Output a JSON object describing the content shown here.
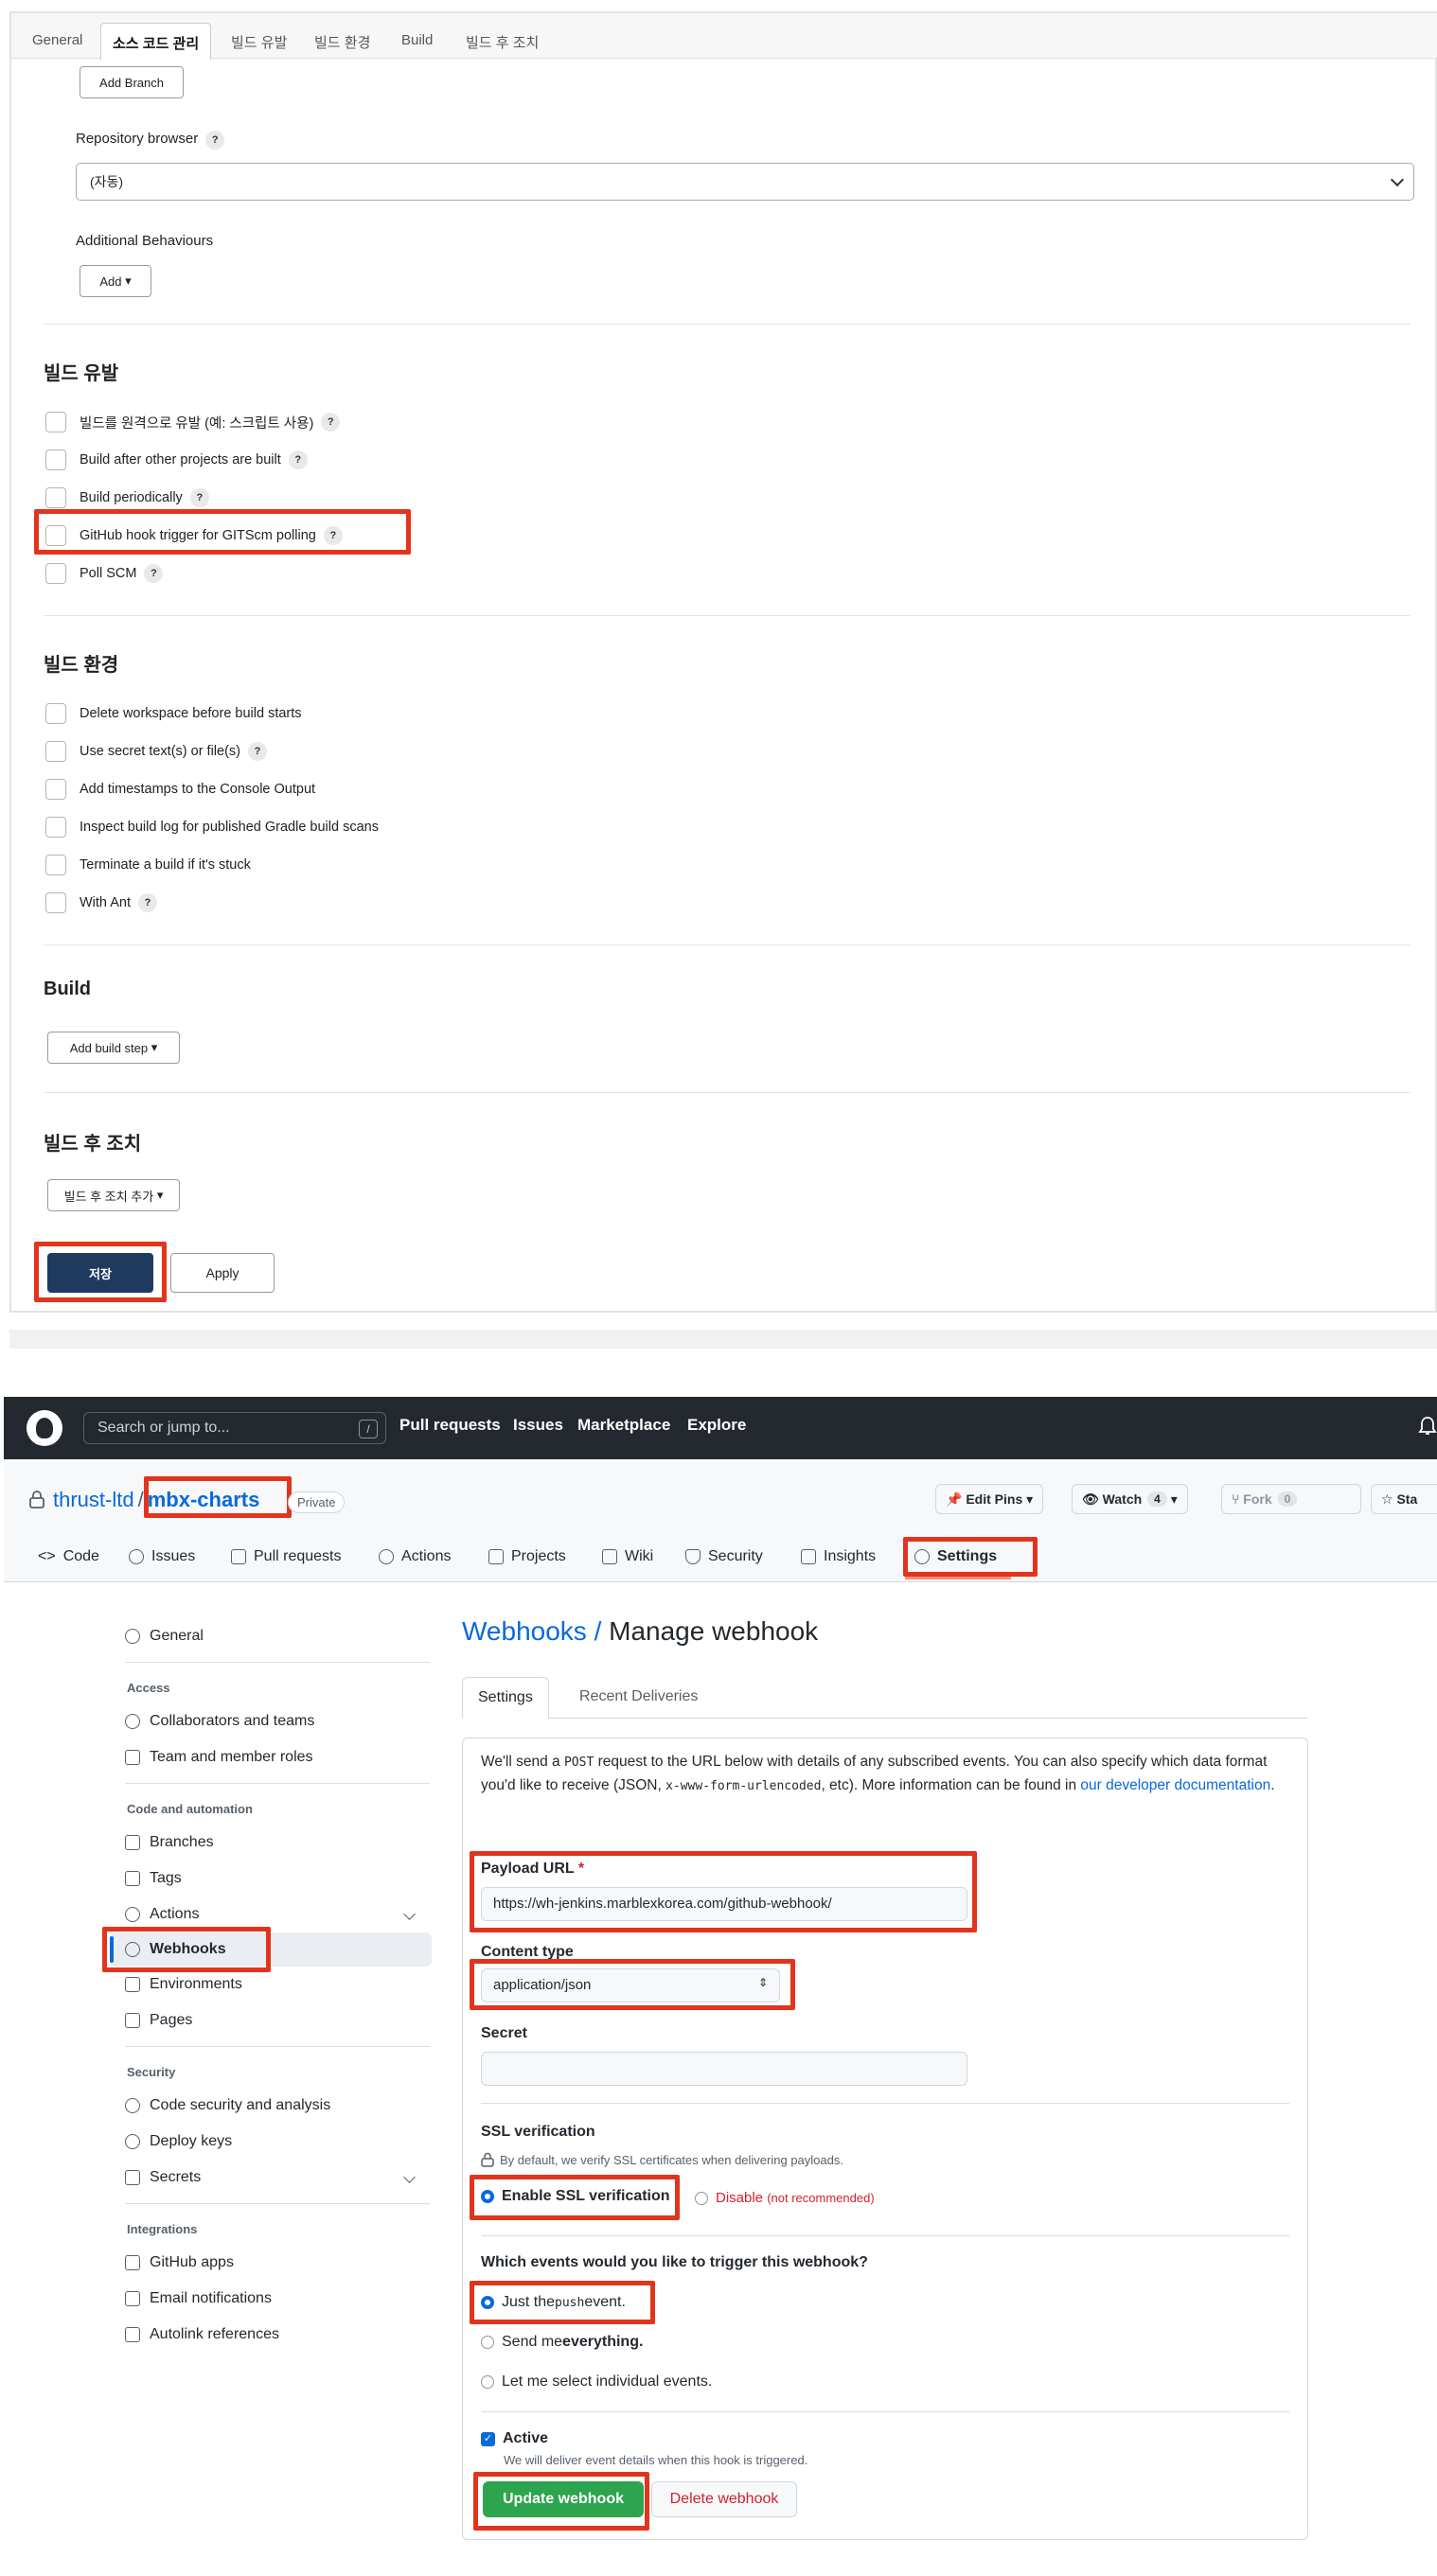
{
  "jenkins": {
    "tabs": [
      "General",
      "소스 코드 관리",
      "빌드 유발",
      "빌드 환경",
      "Build",
      "빌드 후 조치"
    ],
    "add_branch": "Add Branch",
    "repo_browser_label": "Repository browser",
    "repo_browser_value": "(자동)",
    "additional_behaviours": "Additional Behaviours",
    "add_btn": "Add",
    "help": "?",
    "triggers_title": "빌드 유발",
    "triggers": [
      "빌드를 원격으로 유발 (예: 스크립트 사용)",
      "Build after other projects are built",
      "Build periodically",
      "GitHub hook trigger for GITScm polling",
      "Poll SCM"
    ],
    "env_title": "빌드 환경",
    "env": [
      "Delete workspace before build starts",
      "Use secret text(s) or file(s)",
      "Add timestamps to the Console Output",
      "Inspect build log for published Gradle build scans",
      "Terminate a build if it's stuck",
      "With Ant"
    ],
    "build_title": "Build",
    "add_build_step": "Add build step",
    "post_title": "빌드 후 조치",
    "add_post": "빌드 후 조치 추가",
    "save": "저장",
    "apply": "Apply"
  },
  "github": {
    "search_placeholder": "Search or jump to...",
    "slash": "/",
    "nav": [
      "Pull requests",
      "Issues",
      "Marketplace",
      "Explore"
    ],
    "owner": "thrust-ltd",
    "sep": "/",
    "repo": "mbx-charts",
    "private": "Private",
    "edit_pins": "Edit Pins",
    "watch": "Watch",
    "watch_count": "4",
    "fork": "Fork",
    "fork_count": "0",
    "star": "Sta",
    "repo_tabs": [
      "Code",
      "Issues",
      "Pull requests",
      "Actions",
      "Projects",
      "Wiki",
      "Security",
      "Insights",
      "Settings"
    ],
    "sidebar": {
      "general": "General",
      "access_head": "Access",
      "access": [
        "Collaborators and teams",
        "Team and member roles"
      ],
      "code_head": "Code and automation",
      "code": [
        "Branches",
        "Tags",
        "Actions",
        "Webhooks",
        "Environments",
        "Pages"
      ],
      "security_head": "Security",
      "security": [
        "Code security and analysis",
        "Deploy keys",
        "Secrets"
      ],
      "integrations_head": "Integrations",
      "integrations": [
        "GitHub apps",
        "Email notifications",
        "Autolink references"
      ]
    },
    "heading_link": "Webhooks /",
    "heading": " Manage webhook",
    "tabs": [
      "Settings",
      "Recent Deliveries"
    ],
    "intro_a": "We'll send a ",
    "intro_post": "POST",
    "intro_b": " request to the URL below with details of any subscribed events. You can also specify which data format you'd like to receive (JSON, ",
    "intro_code": "x-www-form-urlencoded",
    "intro_c": ", etc). More information can be found in ",
    "intro_link": "our developer documentation",
    "intro_d": ".",
    "payload_label": "Payload URL",
    "req": "*",
    "payload_url": "https://wh-jenkins.marblexkorea.com/github-webhook/",
    "content_type_label": "Content type",
    "content_type": "application/json",
    "secret_label": "Secret",
    "ssl_label": "SSL verification",
    "ssl_note": "By default, we verify SSL certificates when delivering payloads.",
    "ssl_enable": "Enable SSL verification",
    "ssl_disable": "Disable",
    "ssl_not_rec": "(not recommended)",
    "events_q": "Which events would you like to trigger this webhook?",
    "ev_push_a": "Just the ",
    "ev_push_code": "push",
    "ev_push_b": " event.",
    "ev_all_a": "Send me ",
    "ev_all_b": "everything.",
    "ev_select": "Let me select individual events.",
    "active": "Active",
    "active_note": "We will deliver event details when this hook is triggered.",
    "update": "Update webhook",
    "delete": "Delete webhook"
  }
}
